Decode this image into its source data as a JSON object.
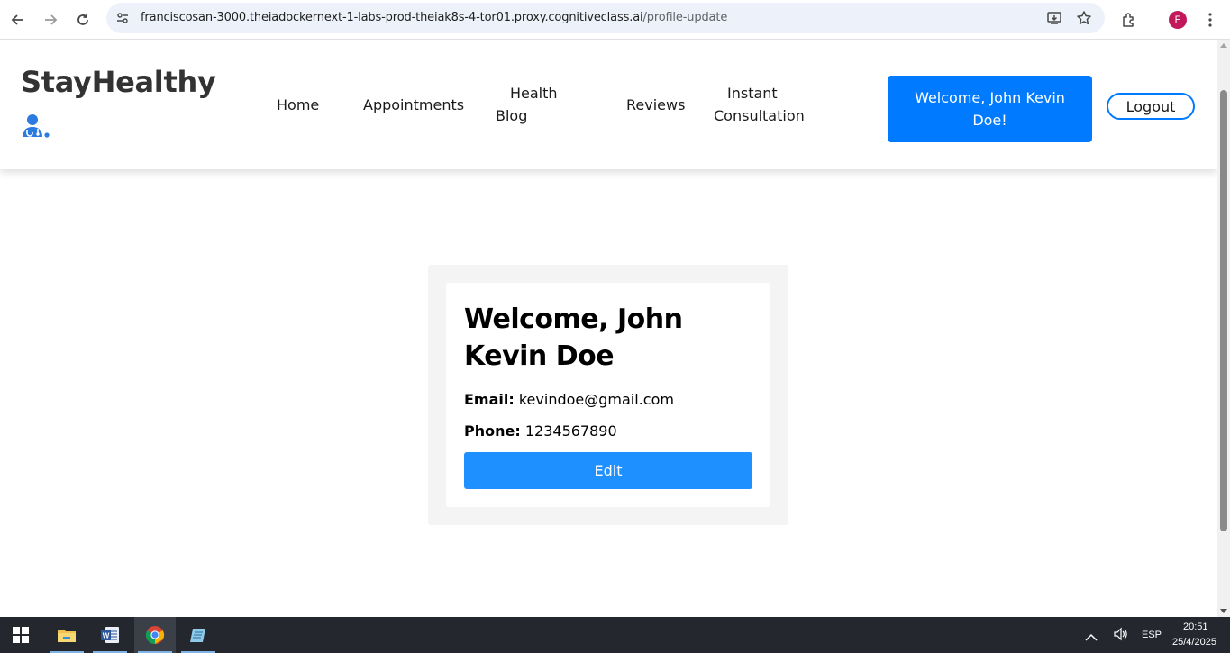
{
  "browser": {
    "url_host": "franciscosan-3000.theiadockernext-1-labs-prod-theiak8s-4-tor01.proxy.cognitiveclass.ai",
    "url_path": "/profile-update",
    "profile_initial": "F",
    "icons": [
      "back-icon",
      "forward-icon",
      "reload-icon",
      "site-settings-icon",
      "install-app-icon",
      "bookmark-star-icon",
      "extensions-icon",
      "menu-dots-icon"
    ]
  },
  "navbar": {
    "brand": "StayHealthy",
    "links": {
      "home": "Home",
      "appointments": "Appointments",
      "health_blog_1": "Health",
      "health_blog_2": "Blog",
      "reviews": "Reviews",
      "instant_1": "Instant",
      "instant_2": "Consultation"
    },
    "welcome_line1": "Welcome, John Kevin",
    "welcome_line2": "Doe!",
    "logout": "Logout",
    "accent_color": "#007bff"
  },
  "profile": {
    "title": "Welcome, John Kevin Doe",
    "email_label": "Email:",
    "email": "kevindoe@gmail.com",
    "phone_label": "Phone:",
    "phone": "1234567890",
    "edit": "Edit",
    "button_color": "#1e90ff"
  },
  "taskbar": {
    "apps": [
      "windows-start-icon",
      "file-explorer-icon",
      "word-icon",
      "chrome-icon",
      "notepad-icon"
    ],
    "language": "ESP",
    "time": "20:51",
    "date": "25/4/2025"
  }
}
